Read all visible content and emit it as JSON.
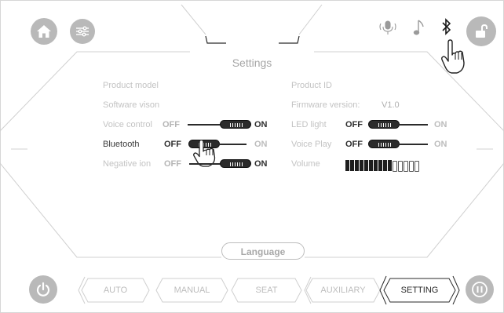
{
  "header": {
    "title": "Settings"
  },
  "settings": {
    "product_model_label": "Product model",
    "product_id_label": "Product ID",
    "software_version_label": "Software vison",
    "firmware_version_label": "Firmware version:",
    "firmware_version_value": "V1.0",
    "voice_control": {
      "label": "Voice control",
      "off": "OFF",
      "on": "ON",
      "state": "on"
    },
    "bluetooth": {
      "label": "Bluetooth",
      "off": "OFF",
      "on": "ON",
      "state": "off"
    },
    "negative_ion": {
      "label": "Negative ion",
      "off": "OFF",
      "on": "ON",
      "state": "on"
    },
    "led_light": {
      "label": "LED  light",
      "off": "OFF",
      "on": "ON",
      "state": "off"
    },
    "voice_play": {
      "label": "Voice Play",
      "off": "OFF",
      "on": "ON",
      "state": "off"
    },
    "volume": {
      "label": "Volume",
      "level": 10,
      "max": 15
    }
  },
  "language_button": "Language",
  "tabs": [
    {
      "label": "AUTO",
      "active": false
    },
    {
      "label": "MANUAL",
      "active": false
    },
    {
      "label": "SEAT",
      "active": false
    },
    {
      "label": "AUXILIARY",
      "active": false
    },
    {
      "label": "SETTING",
      "active": true
    }
  ],
  "icons": {
    "top_left": [
      "home-icon",
      "sliders-icon"
    ],
    "top_right": [
      "microphone-icon",
      "music-note-icon",
      "bluetooth-icon",
      "unlock-icon"
    ],
    "bottom": [
      "power-icon",
      "pause-icon"
    ]
  },
  "colors": {
    "button_gray": "#b9b9b9",
    "line_gray": "#cfcfcf",
    "active_text": "#2a2a2a"
  }
}
